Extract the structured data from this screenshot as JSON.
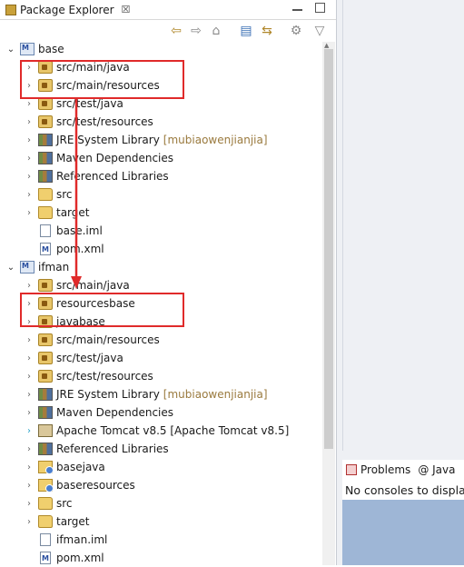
{
  "explorer": {
    "tab_label": "Package Explorer",
    "tab_close": "☒",
    "toolbar": {
      "back_icon": "⇦",
      "forward_icon": "⇨",
      "home_icon": "⌂",
      "collapse_icon": "▤",
      "link_icon": "⇆",
      "filter_icon": "⚙",
      "menu_icon": "▽"
    },
    "rows": [
      {
        "label": "base",
        "decor": "",
        "icon": "project",
        "arrow": "expanded"
      },
      {
        "label": "src/main/java",
        "decor": "",
        "icon": "package-folder",
        "arrow": "collapsed"
      },
      {
        "label": "src/main/resources",
        "decor": "",
        "icon": "package-folder",
        "arrow": "collapsed"
      },
      {
        "label": "src/test/java",
        "decor": "",
        "icon": "package-folder",
        "arrow": "collapsed"
      },
      {
        "label": "src/test/resources",
        "decor": "",
        "icon": "package-folder",
        "arrow": "collapsed"
      },
      {
        "label": "JRE System Library",
        "decor": "[mubiaowenjianjia]",
        "icon": "library",
        "arrow": "collapsed"
      },
      {
        "label": "Maven Dependencies",
        "decor": "",
        "icon": "library",
        "arrow": "collapsed"
      },
      {
        "label": "Referenced Libraries",
        "decor": "",
        "icon": "library",
        "arrow": "collapsed"
      },
      {
        "label": "src",
        "decor": "",
        "icon": "folder",
        "arrow": "collapsed"
      },
      {
        "label": "target",
        "decor": "",
        "icon": "folder",
        "arrow": "collapsed"
      },
      {
        "label": "base.iml",
        "decor": "",
        "icon": "file",
        "arrow": "none"
      },
      {
        "label": "pom.xml",
        "decor": "",
        "icon": "maven-file",
        "arrow": "none"
      },
      {
        "label": "ifman",
        "decor": "",
        "icon": "project",
        "arrow": "expanded"
      },
      {
        "label": "src/main/java",
        "decor": "",
        "icon": "package-folder",
        "arrow": "collapsed"
      },
      {
        "label": "resourcesbase",
        "decor": "",
        "icon": "linked-package-folder",
        "arrow": "collapsed"
      },
      {
        "label": "javabase",
        "decor": "",
        "icon": "linked-package-folder",
        "arrow": "collapsed"
      },
      {
        "label": "src/main/resources",
        "decor": "",
        "icon": "package-folder",
        "arrow": "collapsed"
      },
      {
        "label": "src/test/java",
        "decor": "",
        "icon": "package-folder",
        "arrow": "collapsed"
      },
      {
        "label": "src/test/resources",
        "decor": "",
        "icon": "package-folder",
        "arrow": "collapsed"
      },
      {
        "label": "JRE System Library",
        "decor": "[mubiaowenjianjia]",
        "icon": "library",
        "arrow": "collapsed"
      },
      {
        "label": "Maven Dependencies",
        "decor": "",
        "icon": "library",
        "arrow": "collapsed"
      },
      {
        "label": "Apache Tomcat v8.5 [Apache Tomcat v8.5]",
        "decor": "",
        "icon": "server-library",
        "arrow": "collapsed-teal"
      },
      {
        "label": "Referenced Libraries",
        "decor": "",
        "icon": "library",
        "arrow": "collapsed"
      },
      {
        "label": "basejava",
        "decor": "",
        "icon": "linked-folder",
        "arrow": "collapsed"
      },
      {
        "label": "baseresources",
        "decor": "",
        "icon": "linked-folder",
        "arrow": "collapsed"
      },
      {
        "label": "src",
        "decor": "",
        "icon": "folder",
        "arrow": "collapsed"
      },
      {
        "label": "target",
        "decor": "",
        "icon": "folder",
        "arrow": "collapsed"
      },
      {
        "label": "ifman.iml",
        "decor": "",
        "icon": "file",
        "arrow": "none"
      },
      {
        "label": "pom.xml",
        "decor": "",
        "icon": "maven-file",
        "arrow": "none"
      }
    ],
    "annotation_color": "#e02a2a"
  },
  "console": {
    "tabs": [
      {
        "label": "Problems",
        "icon": "problems-icon"
      },
      {
        "label": "@ Java",
        "icon": "javadoc-icon"
      }
    ],
    "message": "No consoles to display"
  }
}
